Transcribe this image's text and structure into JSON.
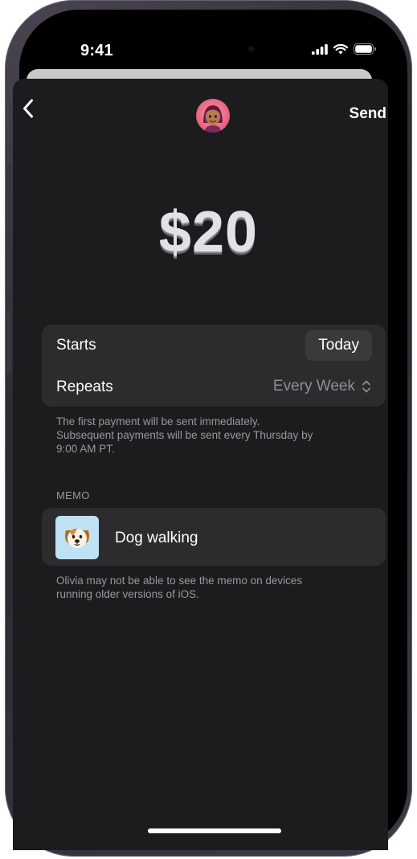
{
  "status_bar": {
    "time": "9:41",
    "icons": [
      "cellular-signal-icon",
      "wifi-icon",
      "battery-icon"
    ]
  },
  "nav": {
    "back_icon": "chevron-left-icon",
    "send_label": "Send",
    "avatar": "memoji-avatar"
  },
  "amount": "$20",
  "schedule": {
    "starts_label": "Starts",
    "starts_value": "Today",
    "repeats_label": "Repeats",
    "repeats_value": "Every Week",
    "repeats_icon": "chevron-up-down-icon"
  },
  "schedule_note": {
    "line1": "The first payment will be sent immediately.",
    "line2": "Subsequent payments will be sent every Thursday by",
    "line3": "9:00 AM PT."
  },
  "memo": {
    "header": "MEMO",
    "sticker": "dog-face-sticker",
    "text": "Dog walking"
  },
  "memo_note": {
    "line1": "Olivia may not be able to see the memo on devices",
    "line2": "running older versions of iOS."
  },
  "colors": {
    "background": "#000000",
    "sheet": "#1c1c1e",
    "card": "#2c2c2e",
    "pill": "#3a3a3c",
    "secondary_text": "#98989d",
    "primary_text": "#ffffff"
  }
}
